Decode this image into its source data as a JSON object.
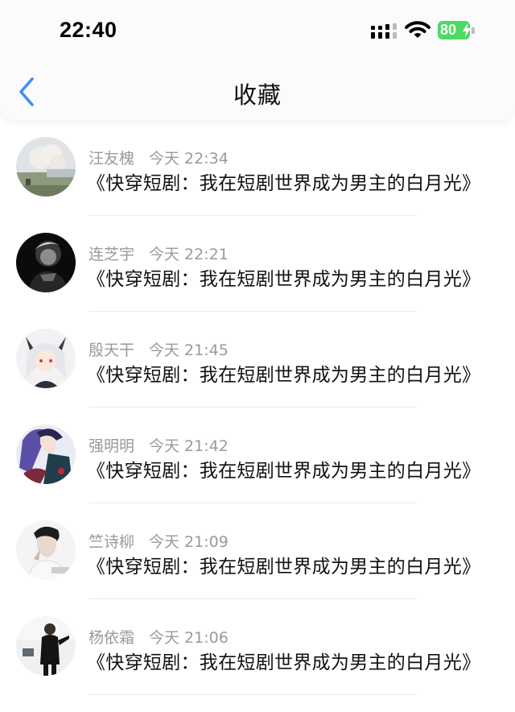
{
  "status_bar": {
    "time": "22:40",
    "battery": "80"
  },
  "header": {
    "title": "收藏"
  },
  "favorites": [
    {
      "name": "汪友槐",
      "time": "今天 22:34",
      "content": "《快穿短剧：我在短剧世界成为男主的白月光》"
    },
    {
      "name": "连芝宇",
      "time": "今天 22:21",
      "content": "《快穿短剧：我在短剧世界成为男主的白月光》"
    },
    {
      "name": "殷天干",
      "time": "今天 21:45",
      "content": "《快穿短剧：我在短剧世界成为男主的白月光》"
    },
    {
      "name": "强明明",
      "time": "今天 21:42",
      "content": "《快穿短剧：我在短剧世界成为男主的白月光》"
    },
    {
      "name": "竺诗柳",
      "time": "今天 21:09",
      "content": "《快穿短剧：我在短剧世界成为男主的白月光》"
    },
    {
      "name": "杨依霜",
      "time": "今天 21:06",
      "content": "《快穿短剧：我在短剧世界成为男主的白月光》"
    }
  ],
  "colors": {
    "accent": "#3d8ef0",
    "battery": "#4cd964",
    "meta_text": "#9a9a9a"
  }
}
